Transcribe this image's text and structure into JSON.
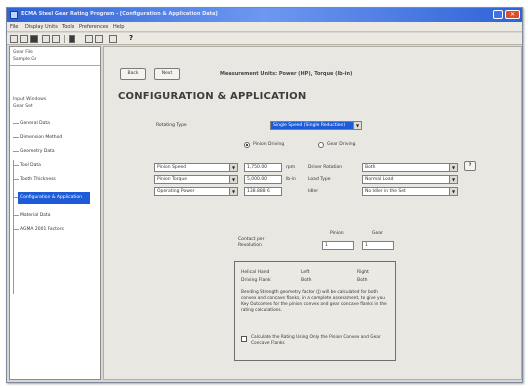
{
  "window": {
    "title": "ECMA Steel Gear Rating Program - [Configuration & Application Data]"
  },
  "menu": {
    "items": [
      "File",
      "Display Units",
      "Tools",
      "Preferences",
      "Help"
    ]
  },
  "sidebar": {
    "top_labels": [
      "Gear File",
      "Sample.Gr"
    ],
    "section_labels": [
      "Input Windows",
      "Gear Set"
    ],
    "items": [
      {
        "label": "General Data"
      },
      {
        "label": "Dimension Method"
      },
      {
        "label": "Geometry Data"
      },
      {
        "label": "Tool Data"
      },
      {
        "label": "Tooth Thickness"
      },
      {
        "label": "Configuration & Application"
      },
      {
        "label": "Material Data"
      },
      {
        "label": "AGMA 2001 Factors"
      }
    ],
    "selected_index": 5
  },
  "toolbar": {
    "back_label": "Back",
    "next_label": "Next"
  },
  "units_text": "Measurement Units: Power (HP), Torque (lb-in)",
  "page_title": "CONFIGURATION & APPLICATION",
  "driving_type": {
    "label": "Rotating Type",
    "value": "Single Speed (Single Reduction)"
  },
  "driving_options": {
    "pinion_label": "Pinion Driving",
    "gear_label": "Gear Driving",
    "selected": "pinion"
  },
  "left_fields": [
    {
      "combo": "Pinion Speed",
      "value": "1,750.00",
      "unit": "rpm"
    },
    {
      "combo": "Pinion Torque",
      "value": "5,000.00",
      "unit": "lb-in"
    },
    {
      "combo": "Operating Power",
      "value": "138.888 6",
      "unit": ""
    }
  ],
  "right_fields": [
    {
      "label": "Driver Rotation",
      "value": "Both"
    },
    {
      "label": "Load Type",
      "value": "Normal Load"
    },
    {
      "label": "Idler",
      "value": "No Idler in the Set"
    }
  ],
  "help_button": "?",
  "contact_per_revolution": {
    "label_line1": "Contact per",
    "label_line2": "Revolution",
    "pinion_header": "Pinion",
    "gear_header": "Gear",
    "pinion_value": "1",
    "gear_value": "1"
  },
  "info_box": {
    "rows": [
      {
        "label": "Helical Hand",
        "pinion": "Left",
        "gear": "Right"
      },
      {
        "label": "Driving Flank",
        "pinion": "Both",
        "gear": "Both"
      }
    ],
    "text": "Bending Strength geometry factor (J) will be calculated for both convex and concave flanks, in a complete assessment, to give you Key Outcomes for the pinion convex and gear concave flanks in the rating calculations.",
    "checkbox_label": "Calculate the Rating Using Only the Pinion Convex and Gear Concave Flanks",
    "checked": false
  },
  "colors": {
    "selection": "#1d5bd8",
    "title_bar": "#2f63d6"
  }
}
